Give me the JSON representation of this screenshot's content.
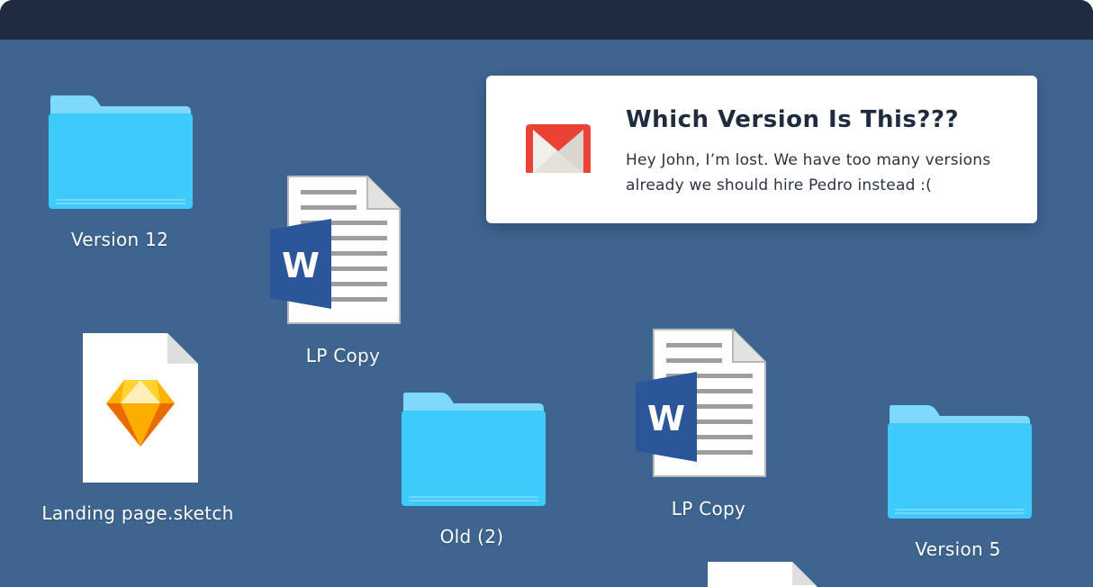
{
  "desktop_items": [
    {
      "type": "folder",
      "name": "Version 12"
    },
    {
      "type": "word-document",
      "name": "LP Copy"
    },
    {
      "type": "sketch-file",
      "name": "Landing page.sketch"
    },
    {
      "type": "folder",
      "name": "Old (2)"
    },
    {
      "type": "word-document",
      "name": "LP Copy"
    },
    {
      "type": "folder",
      "name": "Version 5"
    }
  ],
  "notification": {
    "app_icon": "gmail-icon",
    "title": "Which Version Is This???",
    "message": "Hey John, I’m lost. We have too many versions already we should hire Pedro instead :("
  },
  "colors": {
    "title_bar": "#1f2b3e",
    "desktop": "#3e6590",
    "folder": "#3ecbfb",
    "word_blue": "#2b579a",
    "gmail_red": "#ea4335"
  }
}
